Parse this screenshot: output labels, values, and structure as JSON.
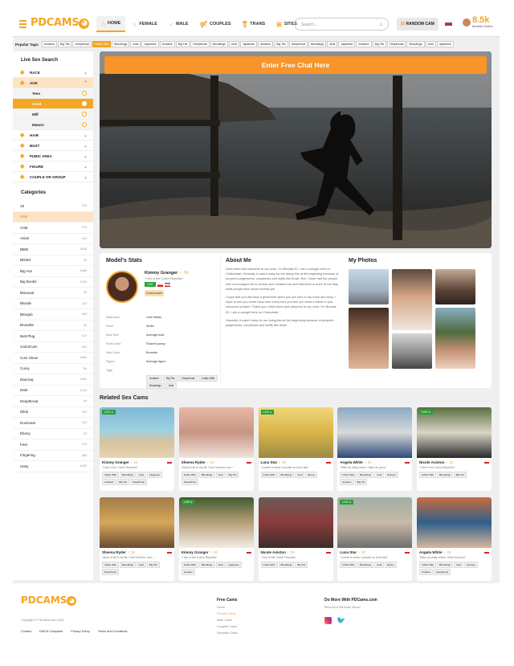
{
  "header": {
    "logo": "PDCAMS",
    "nav": [
      {
        "label": "HOME",
        "icon": "home-icon",
        "glyph": "⌂"
      },
      {
        "label": "FEMALE",
        "icon": "female-icon",
        "glyph": "♀"
      },
      {
        "label": "MALE",
        "icon": "male-icon",
        "glyph": "♂"
      },
      {
        "label": "COUPLES",
        "icon": "couple-icon",
        "glyph": "⚤"
      },
      {
        "label": "TRANS",
        "icon": "trans-icon",
        "glyph": "⚧"
      },
      {
        "label": "SITES",
        "icon": "sites-icon",
        "glyph": "⊞"
      }
    ],
    "search_placeholder": "Search...",
    "random_cam": "RANDOM CAM",
    "online_count": "8.5k",
    "online_label": "Models Online"
  },
  "popular_tags_label": "Popular Tags:",
  "popular_tags": [
    "Amateur",
    "Big Tits",
    "Deepthroat",
    "Indian Wife",
    "Bloodlings",
    "Anal",
    "Japanese",
    "Amateur",
    "Big Tits",
    "Deepthroat",
    "Bloodlings",
    "Anal",
    "Japanese",
    "Amateur",
    "Big Tits",
    "Deepthroat",
    "Bloodlings",
    "Anal",
    "Japanese",
    "Amateur",
    "Big Tits",
    "Deepthroat",
    "Bloodlings",
    "Anal",
    "Japanese"
  ],
  "sidebar": {
    "title": "Live Sex Search",
    "filters": [
      {
        "label": "RACE",
        "icon": "race-icon"
      },
      {
        "label": "AGE",
        "icon": "age-icon",
        "expanded": true
      }
    ],
    "age_options": [
      {
        "label": "Teen",
        "active": false
      },
      {
        "label": "Coed",
        "active": true
      },
      {
        "label": "Milf",
        "active": false
      },
      {
        "label": "Mature",
        "active": false
      }
    ],
    "filters2": [
      {
        "label": "HAIR",
        "icon": "hair-icon"
      },
      {
        "label": "BUST",
        "icon": "bust-icon"
      },
      {
        "label": "PUBIC AREA",
        "icon": "pubic-icon"
      },
      {
        "label": "FIGURE",
        "icon": "figure-icon"
      },
      {
        "label": "COUPLE OR GROUP",
        "icon": "group-icon"
      }
    ],
    "categories_title": "Categories",
    "categories": [
      {
        "name": "18",
        "count": "245"
      },
      {
        "name": "Anal",
        "count": "",
        "active": true
      },
      {
        "name": "Arab",
        "count": "123"
      },
      {
        "name": "Asian",
        "count": "164"
      },
      {
        "name": "BBW",
        "count": "4836"
      },
      {
        "name": "BDSM",
        "count": "36"
      },
      {
        "name": "Big Ass",
        "count": "4888"
      },
      {
        "name": "Big Boobs",
        "count": "1221"
      },
      {
        "name": "Bisexual",
        "count": "46"
      },
      {
        "name": "Blonde",
        "count": "702"
      },
      {
        "name": "Blowjob",
        "count": "340"
      },
      {
        "name": "Brunette",
        "count": "53"
      },
      {
        "name": "Butt Plug",
        "count": "124"
      },
      {
        "name": "Cam2Cam",
        "count": "490"
      },
      {
        "name": "Cum Show",
        "count": "4830"
      },
      {
        "name": "Curvy",
        "count": "56"
      },
      {
        "name": "Dancing",
        "count": "4540"
      },
      {
        "name": "Dark",
        "count": "1221"
      },
      {
        "name": "Deepthroat",
        "count": "46"
      },
      {
        "name": "Dildo",
        "count": "702"
      },
      {
        "name": "Dominant",
        "count": "340"
      },
      {
        "name": "Ebony",
        "count": "23"
      },
      {
        "name": "Feet",
        "count": "124"
      },
      {
        "name": "Fingering",
        "count": "488"
      },
      {
        "name": "Hairy",
        "count": "4830"
      }
    ]
  },
  "hero": {
    "cta": "Enter Free Chat Here"
  },
  "model": {
    "stats_title": "Model's Stats",
    "name": "Kimmy Granger",
    "age": "24",
    "quote": "\"I live in the Czech Republic\"",
    "live": "LIVE",
    "site_badge": "Chaturbate",
    "details": [
      {
        "k": "Nickname",
        "v": "Lola Harlan"
      },
      {
        "k": "Race",
        "v": "White"
      },
      {
        "k": "Bust Size",
        "v": "Average bust"
      },
      {
        "k": "Pubic Area",
        "v": "Shaved pussy"
      },
      {
        "k": "Hair Color",
        "v": "Brunette"
      },
      {
        "k": "Figure",
        "v": "Average figure"
      },
      {
        "k": "Tags",
        "v": ""
      }
    ],
    "tags": [
      "Amateur",
      "Big Tits",
      "Deepthroat",
      "Indian Wife",
      "Bloodlings",
      "Anal"
    ]
  },
  "about": {
    "title": "About Me",
    "p1": "Hello there and welcome to my room. I'm Brenda 20. I am a camgirl here on Chaturbate. Honestly, it wasn't easy for me doing this at the beginning because of people's judgements, complexes and stuffs like those. But, I have met the people who encouraged me to do this and I realized as well that there is more of me than what people think about me/this job.",
    "p2": "I hope that you will have a great time when you are here in my room and story. I hope to see you come back here every time you feel you need a friend or just someone to listen. Thank you. Hello there and welcome to my room. I'm Brenda 20. I am a camgirl here on Chaturbate.",
    "p3": "Honestly, it wasn't easy for me doing this at the beginning because of people's judgements, complexes and stuffs like those."
  },
  "photos": {
    "title": "My Photos"
  },
  "related": {
    "title": "Related Sex Cams",
    "cards": [
      {
        "name": "Kimmy Granger",
        "age": "24",
        "quote": "\"I live in the Czech Republic\"",
        "live": true,
        "tags": [
          "Indian Wife",
          "Bloodlings",
          "Anal",
          "Japanese",
          "Amateur",
          "Big Tits",
          "Deepthroat"
        ]
      },
      {
        "name": "Sheena Ryder",
        "age": "18",
        "quote": "\"Most of all in my life I love freedom and...\"",
        "live": false,
        "tags": [
          "Indian Wife",
          "Bloodlings",
          "Anal",
          "Big Tits",
          "Deepthroat"
        ]
      },
      {
        "name": "Luna Star",
        "age": "30",
        "quote": "\"I prefer to keep it private so don't ask\"",
        "live": true,
        "tags": [
          "Indian Wife",
          "Bloodlings",
          "Anal",
          "Ebony"
        ]
      },
      {
        "name": "Angela White",
        "age": "20",
        "quote": "\"Bitte nuj ablig online / think its yours\"",
        "live": false,
        "tags": [
          "Indian Wife",
          "Bloodlings",
          "Anal",
          "Sextoys",
          "Amateur",
          "Big Tits"
        ]
      },
      {
        "name": "Nicole Aniston",
        "age": "20",
        "quote": "\"I live in the Czech Republic\"",
        "live": true,
        "tags": [
          "Indian Wife",
          "Bloodlings",
          "Big Tits"
        ]
      },
      {
        "name": "Sheena Ryder",
        "age": "18",
        "quote": "\"Most of all in my life I love freedom and...\"",
        "live": false,
        "tags": [
          "Indian Wife",
          "Bloodlings",
          "Anal",
          "Big Tits",
          "Deepthroat"
        ]
      },
      {
        "name": "Kimmy Granger",
        "age": "24",
        "quote": "\"I live in the Czech Republic\"",
        "live": true,
        "tags": [
          "Indian Wife",
          "Bloodlings",
          "Anal",
          "Japanese",
          "Amateur"
        ]
      },
      {
        "name": "Nicole Aniston",
        "age": "20",
        "quote": "\"I live in the Czech Republic\"",
        "live": false,
        "tags": [
          "Indian Wife",
          "Bloodlings",
          "Big Tits"
        ]
      },
      {
        "name": "Luna Star",
        "age": "30",
        "quote": "\"I prefer to keep it private so don't ask\"",
        "live": true,
        "tags": [
          "Indian Wife",
          "Bloodlings",
          "Anal",
          "Ebony"
        ]
      },
      {
        "name": "Angela White",
        "age": "20",
        "quote": "\"Bitte nuj ablig online / think its yours\"",
        "live": false,
        "tags": [
          "Indian Wife",
          "Bloodlings",
          "Anal",
          "Sextoys",
          "Amateur",
          "Deepthroat"
        ]
      }
    ]
  },
  "footer": {
    "logo": "PDCAMS",
    "copyright": "Copyright © PDCams.com 2022",
    "links": [
      "Contact",
      "DMCA Complaint",
      "Privacy Policy",
      "Terms and Conditions"
    ],
    "free_cams_title": "Free Cams",
    "free_cams": [
      {
        "label": "Home",
        "active": false
      },
      {
        "label": "Female Cams",
        "active": true
      },
      {
        "label": "Male Cams",
        "active": false
      },
      {
        "label": "Couples Cams",
        "active": false
      },
      {
        "label": "Shemale Cams",
        "active": false
      }
    ],
    "more_title": "Do More With PDCams.com",
    "more_link": "Become A Webcam Model"
  }
}
